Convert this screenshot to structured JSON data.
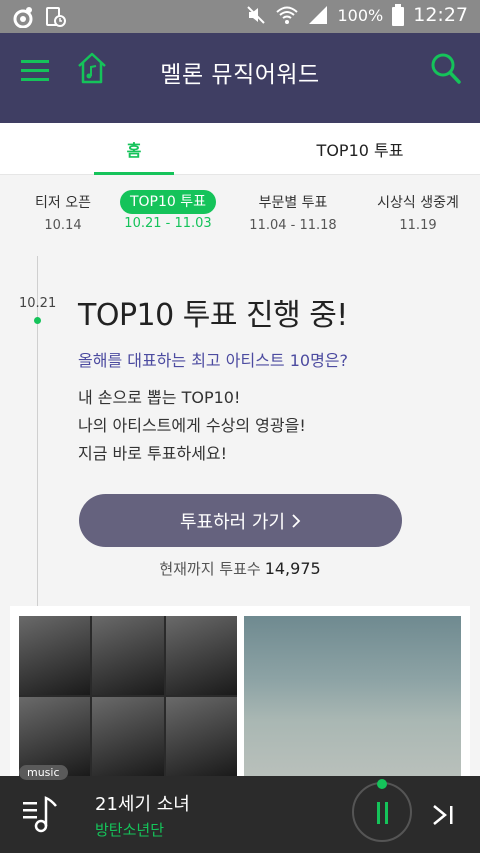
{
  "status_bar": {
    "battery": "100%",
    "time": "12:27"
  },
  "app_bar": {
    "title": "멜론 뮤직어워드"
  },
  "tabs": [
    {
      "label": "홈"
    },
    {
      "label": "TOP10 투표"
    }
  ],
  "stages": [
    {
      "name": "티저 오픈",
      "date": "10.14"
    },
    {
      "name": "TOP10 투표",
      "date": "10.21 - 11.03"
    },
    {
      "name": "부문별 투표",
      "date": "11.04 - 11.18"
    },
    {
      "name": "시상식 생중계",
      "date": "11.19"
    }
  ],
  "timeline": {
    "date": "10.21"
  },
  "main": {
    "headline": "TOP10 투표 진행 중!",
    "question": "올해를 대표하는 최고 아티스트 10명은?",
    "desc_lines": [
      "내 손으로 뽑는 TOP10!",
      "나의 아티스트에게 수상의 영광을!",
      "지금 바로 투표하세요!"
    ],
    "vote_button": "투표하러 가기",
    "vote_count_label": "현재까지 투표수",
    "vote_count": "14,975"
  },
  "player": {
    "tag": "music",
    "song": "21세기 소녀",
    "artist": "방탄소년단"
  },
  "colors": {
    "accent": "#15c35a",
    "header": "#3f3e63",
    "question": "#4c4ba0",
    "button": "#65627e"
  }
}
